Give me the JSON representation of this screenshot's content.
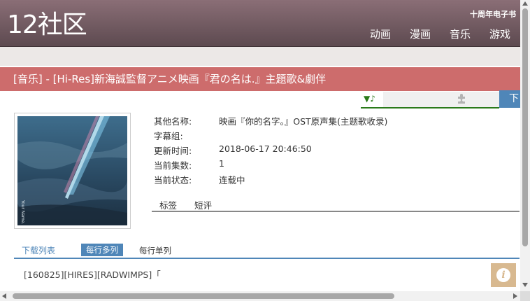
{
  "site": {
    "logo": "12社区",
    "tagline": "十周年电子书",
    "nav": [
      "动画",
      "漫画",
      "音乐",
      "游戏"
    ]
  },
  "title": "[音乐] - [Hi-Res]新海誠監督アニメ映画『君の名は.』主題歌&劇伴",
  "player": {
    "icon": "▼♪",
    "puzzle_icon": "puzzle-icon"
  },
  "download_button": "下",
  "cover": {
    "side_text": "Your Name."
  },
  "info": {
    "rows": [
      {
        "label": "其他名称:",
        "value": "映画『你的名字。』OST原声集(主题歌收录)"
      },
      {
        "label": "字幕组:",
        "value": ""
      },
      {
        "label": "更新时间:",
        "value": "2018-06-17 20:46:50"
      },
      {
        "label": "当前集数:",
        "value": "1"
      },
      {
        "label": "当前状态:",
        "value": "连载中"
      }
    ]
  },
  "tabs": [
    "标签",
    "短评"
  ],
  "download_list": {
    "title": "下载列表",
    "modes": [
      "每行多列",
      "每行单列"
    ],
    "active_mode": "每行多列",
    "first_item": "[160825][HIRES][RADWIMPS]「"
  },
  "info_badge": "i",
  "colors": {
    "header": "#6f5a60",
    "title_bar": "#cd6c6c",
    "accent_blue": "#4f86b8",
    "player_green": "#2a7a1a",
    "badge": "#d8b990"
  }
}
